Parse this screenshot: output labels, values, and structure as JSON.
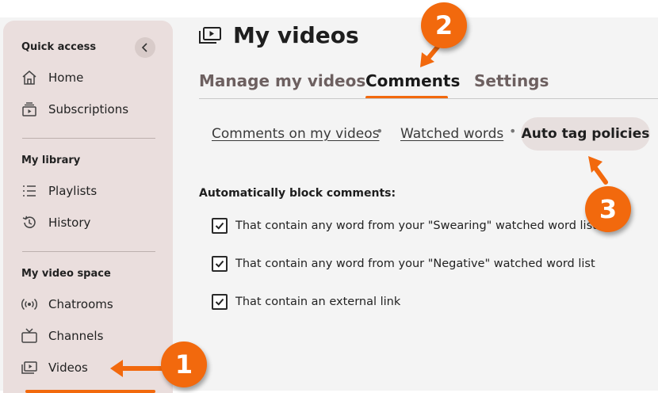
{
  "sidebar": {
    "quick_access_title": "Quick access",
    "quick_access": [
      {
        "label": "Home",
        "icon": "home-icon"
      },
      {
        "label": "Subscriptions",
        "icon": "subscriptions-icon"
      }
    ],
    "library_title": "My library",
    "library": [
      {
        "label": "Playlists",
        "icon": "playlist-icon"
      },
      {
        "label": "History",
        "icon": "history-icon"
      }
    ],
    "space_title": "My video space",
    "space": [
      {
        "label": "Chatrooms",
        "icon": "broadcast-icon"
      },
      {
        "label": "Channels",
        "icon": "tv-icon"
      },
      {
        "label": "Videos",
        "icon": "videos-icon",
        "active": true
      }
    ]
  },
  "main": {
    "title": "My videos",
    "tabs": [
      {
        "label": "Manage my videos",
        "active": false
      },
      {
        "label": "Comments",
        "active": true
      },
      {
        "label": "Settings",
        "active": false
      }
    ],
    "subnav": [
      {
        "label": "Comments on my videos"
      },
      {
        "label": "Watched words"
      },
      {
        "label": "Auto tag policies",
        "active": true
      }
    ],
    "block_title": "Automatically block comments:",
    "checks": [
      {
        "label": "That contain any word from your \"Swearing\" watched word list",
        "checked": true
      },
      {
        "label": "That contain any word from your \"Negative\" watched word list",
        "checked": true
      },
      {
        "label": "That contain an external link",
        "checked": true
      }
    ]
  },
  "annotations": {
    "badge_1": "1",
    "badge_2": "2",
    "badge_3": "3"
  },
  "colors": {
    "accent": "#f2690d",
    "sidebar_bg": "#eadedd",
    "page_bg": "#f4f4f4"
  }
}
